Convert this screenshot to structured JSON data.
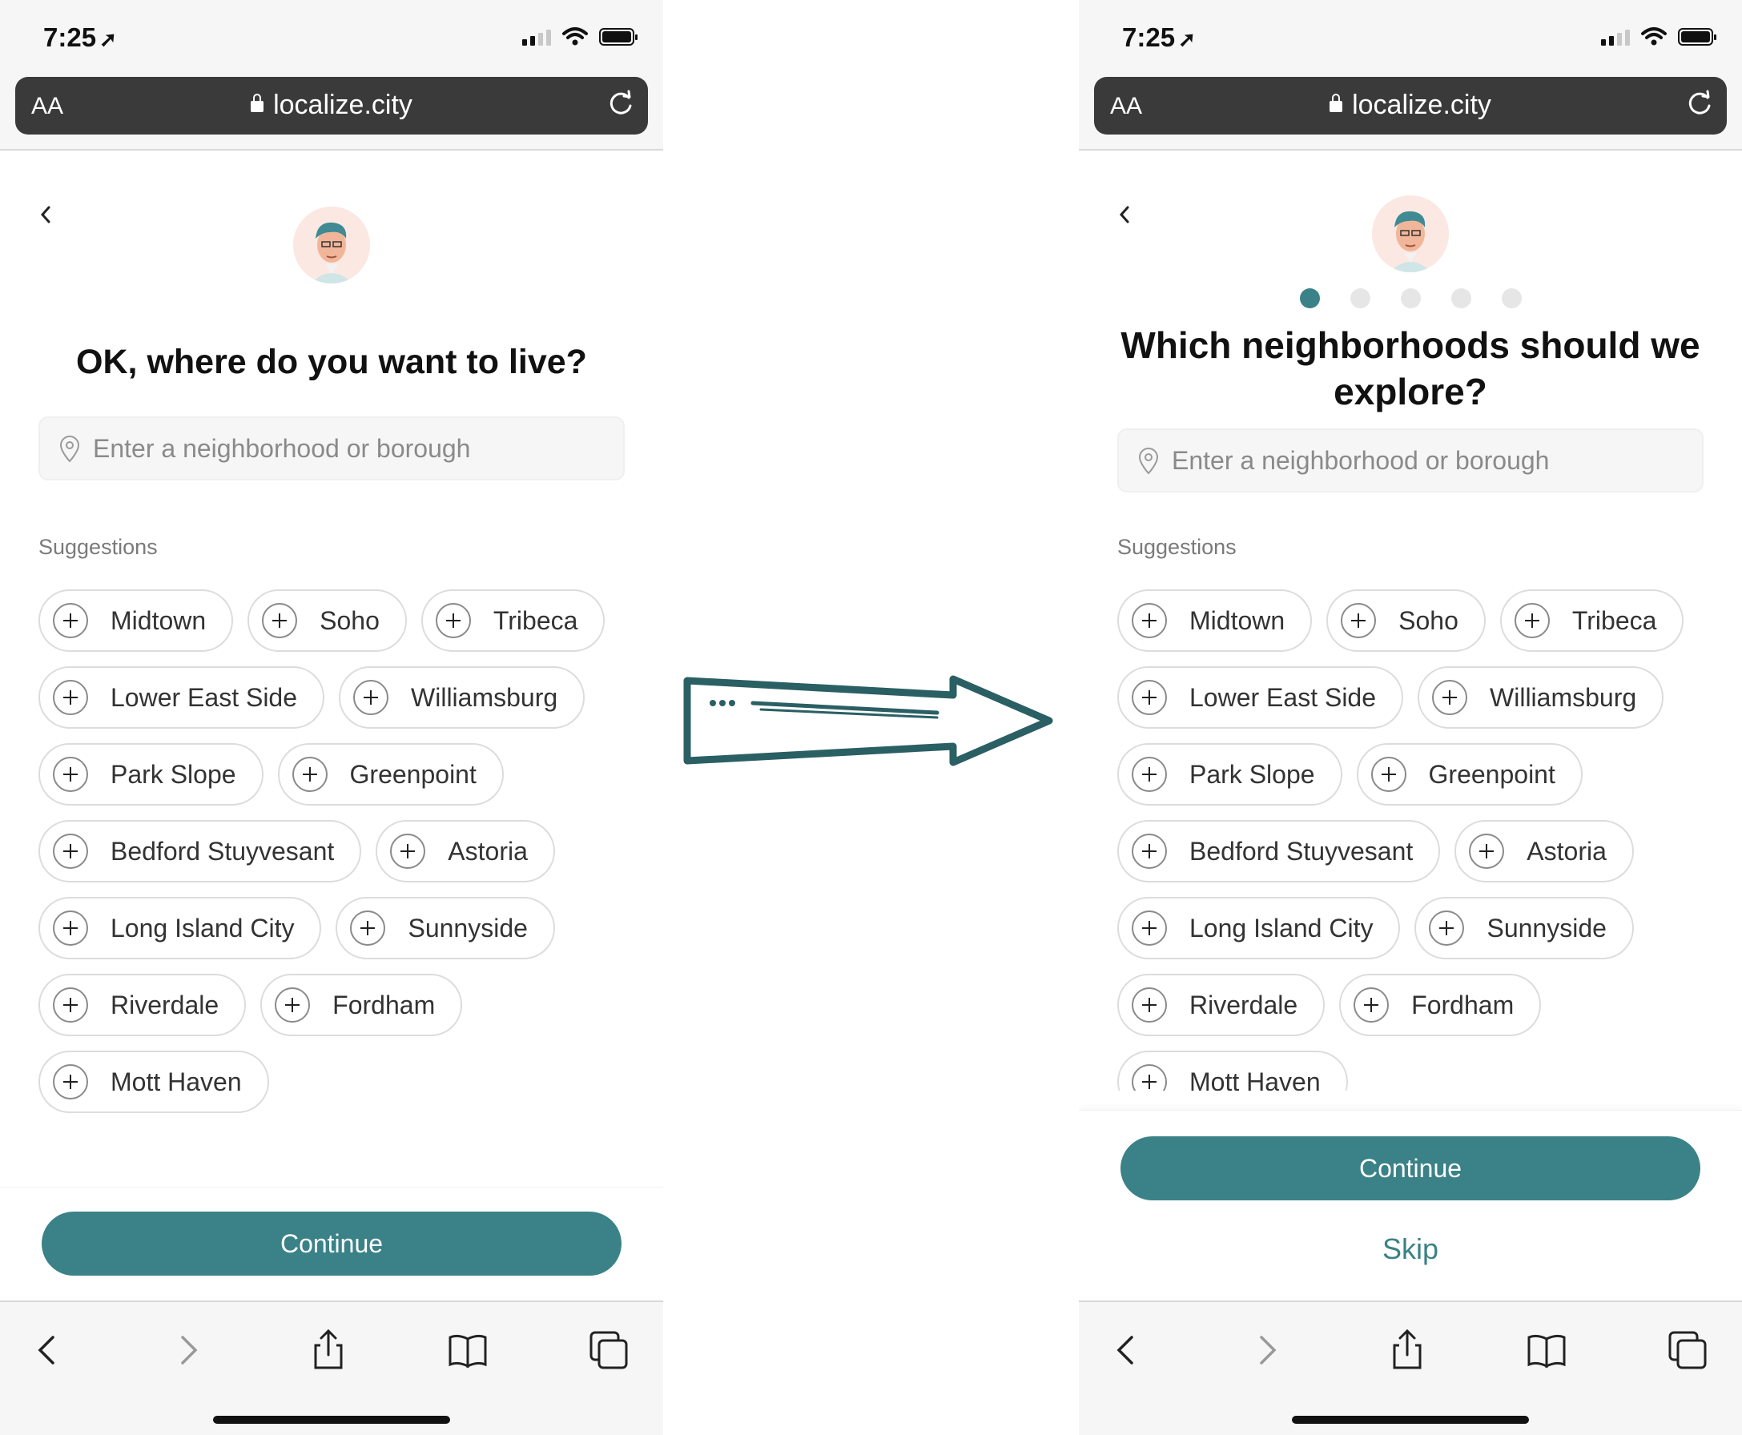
{
  "status": {
    "time": "7:25"
  },
  "browser": {
    "text_size_label": "AA",
    "url": "localize.city"
  },
  "left": {
    "title": "OK, where do you want to live?",
    "search_placeholder": "Enter a neighborhood or borough",
    "suggestions_label": "Suggestions",
    "continue_label": "Continue"
  },
  "right": {
    "progress": {
      "current_step": 1,
      "total_steps": 5
    },
    "title_line1": "Which neighborhoods should we",
    "title_line2": "explore?",
    "search_placeholder": "Enter a neighborhood or borough",
    "suggestions_label": "Suggestions",
    "continue_label": "Continue",
    "skip_label": "Skip"
  },
  "suggestions": [
    [
      "Midtown",
      "Soho",
      "Tribeca"
    ],
    [
      "Lower East Side",
      "Williamsburg"
    ],
    [
      "Park Slope",
      "Greenpoint"
    ],
    [
      "Bedford Stuyvesant",
      "Astoria"
    ],
    [
      "Long Island City",
      "Sunnyside"
    ],
    [
      "Riverdale",
      "Fordham"
    ],
    [
      "Mott Haven"
    ]
  ],
  "colors": {
    "accent": "#3a8287",
    "arrow": "#2a5f63"
  },
  "icons": {
    "back": "chevron-left-icon",
    "forward": "chevron-right-icon",
    "share": "share-icon",
    "bookmarks": "book-icon",
    "tabs": "tabs-icon",
    "pin": "location-pin-icon",
    "add": "plus-circle-icon"
  }
}
